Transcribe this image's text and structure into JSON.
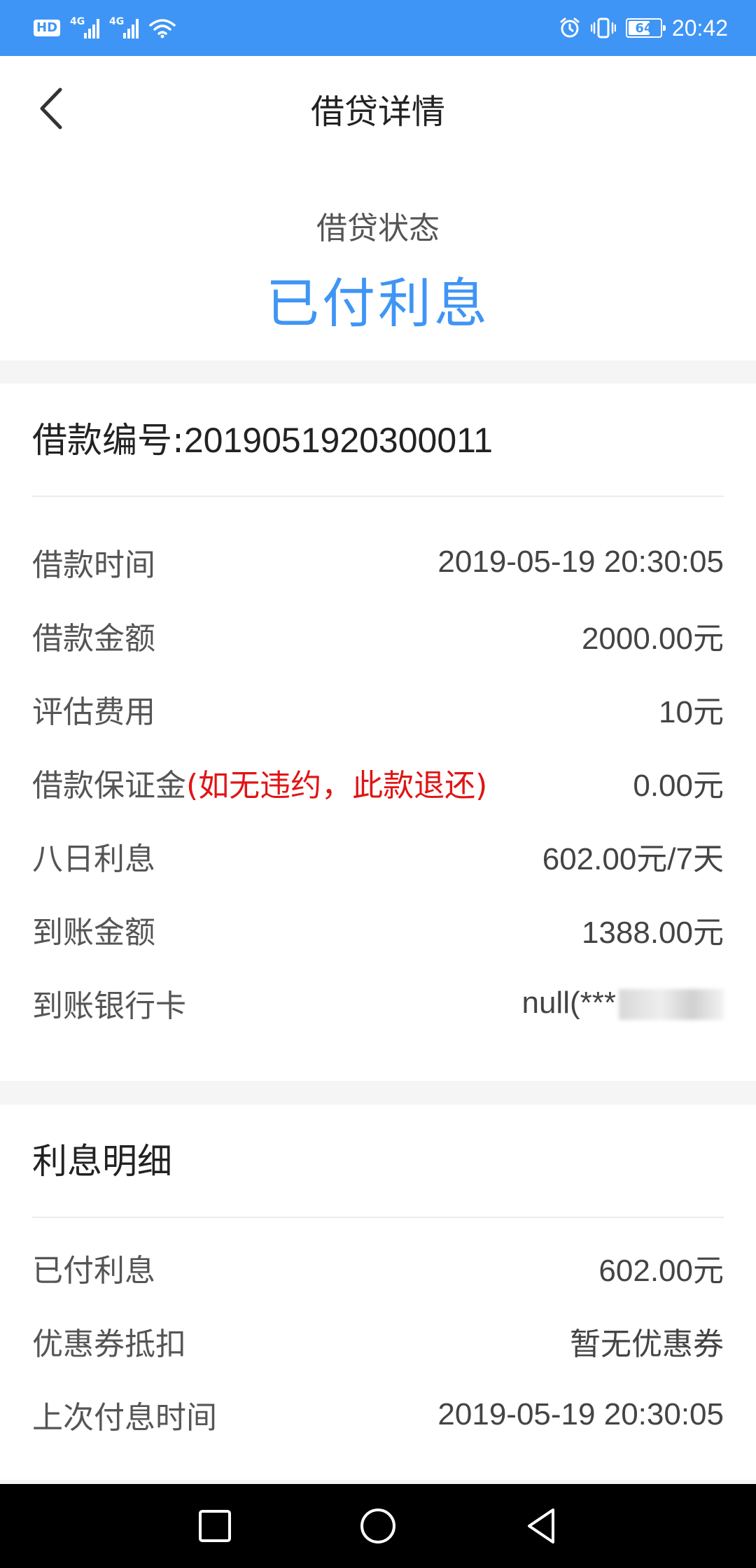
{
  "status_bar": {
    "hd": "HD",
    "network1": "4G",
    "network2": "4G",
    "battery": "64",
    "time": "20:42"
  },
  "header": {
    "title": "借贷详情"
  },
  "loan_status": {
    "label": "借贷状态",
    "value": "已付利息"
  },
  "loan_detail": {
    "title_prefix": "借款编号:",
    "loan_number": "2019051920300011",
    "rows": [
      {
        "key": "借款时间",
        "value": "2019-05-19 20:30:05"
      },
      {
        "key": "借款金额",
        "value": "2000.00元"
      },
      {
        "key": "评估费用",
        "value": "10元"
      },
      {
        "key": "借款保证金",
        "note": "(如无违约，此款退还)",
        "value": "0.00元"
      },
      {
        "key": "八日利息",
        "value": "602.00元/7天"
      },
      {
        "key": "到账金额",
        "value": "1388.00元"
      },
      {
        "key": "到账银行卡",
        "value": "null(***"
      }
    ]
  },
  "interest_detail": {
    "title": "利息明细",
    "rows": [
      {
        "key": "已付利息",
        "value": "602.00元"
      },
      {
        "key": "优惠券抵扣",
        "value": "暂无优惠券"
      },
      {
        "key": "上次付息时间",
        "value": "2019-05-19 20:30:05"
      }
    ]
  },
  "colors": {
    "accent": "#3f95f5",
    "warning": "#e01414"
  }
}
